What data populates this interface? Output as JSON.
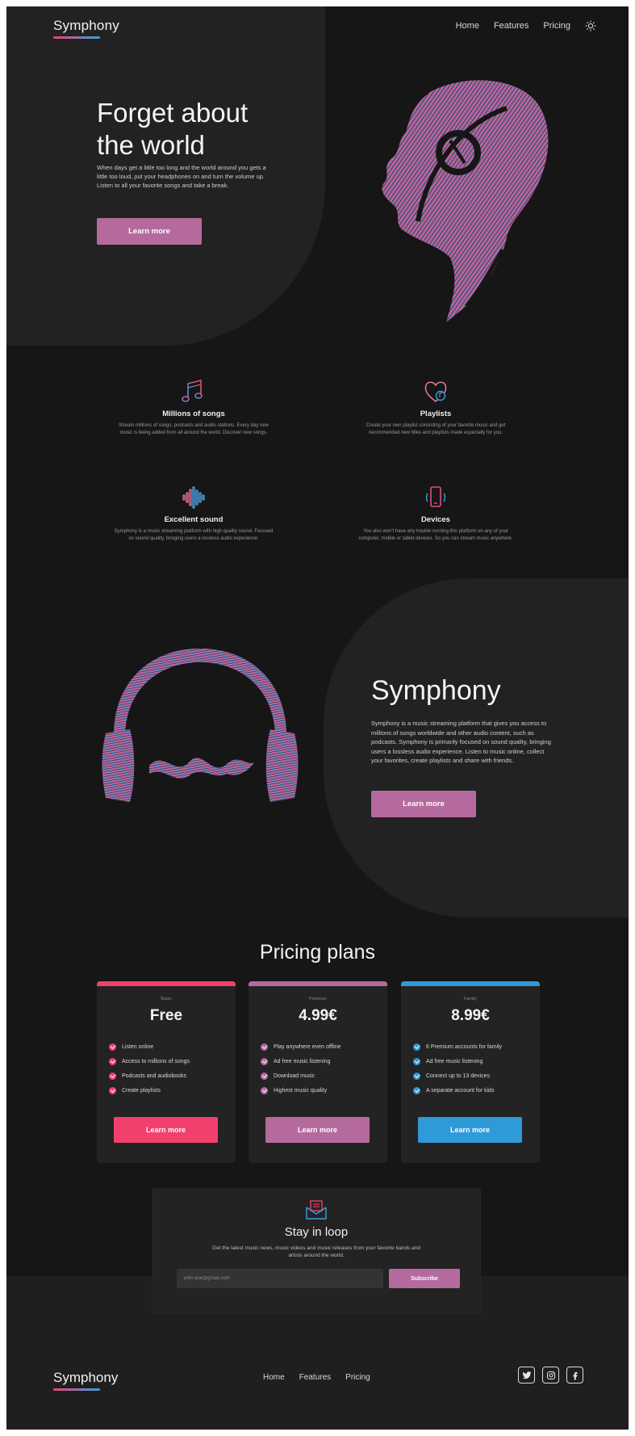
{
  "nav": {
    "logo": "Symphony",
    "links": [
      "Home",
      "Features",
      "Pricing"
    ],
    "theme_icon": "sun-icon"
  },
  "hero": {
    "title": "Forget about the world",
    "text": "When days get a little too long and the world around you gets a little too loud, put your headphones on and turn the volume up. Listen to all your favorite songs and take a break.",
    "button": "Learn more"
  },
  "features": [
    {
      "icon": "music-note-icon",
      "title": "Millions of songs",
      "text": "Stream millions of songs, podcasts and audio stations. Every day new music is being added from all around the world. Discover new songs."
    },
    {
      "icon": "heart-playlist-icon",
      "title": "Playlists",
      "text": "Create your own playlist consisting of your favorite music and get recommended new titles and playlists made especially for you."
    },
    {
      "icon": "sound-wave-icon",
      "title": "Excellent sound",
      "text": "Symphony is a music streaming platform with high quality sound. Focused on sound quality, bringing users a lossless audio experience."
    },
    {
      "icon": "phone-devices-icon",
      "title": "Devices",
      "text": "You also won't have any trouble running this platform on any of your computer, mobile or tablet devices. So you can stream music anywhere."
    }
  ],
  "about": {
    "title": "Symphony",
    "text": "Symphony is a music streaming platform that gives you access to millions of songs worldwide and other audio content, such as podcasts. Symphony is primarily focused on sound quality, bringing users a lossless audio experience. Listen to music online, collect your favorites, create playlists and share with friends.",
    "button": "Learn more"
  },
  "pricing": {
    "title": "Pricing plans",
    "plans": [
      {
        "name": "Basic",
        "price": "Free",
        "color": "#f2406d",
        "features": [
          "Listen online",
          "Access to millions of songs",
          "Podcasts and audiobooks",
          "Create playlists"
        ],
        "button": "Learn more"
      },
      {
        "name": "Premium",
        "price": "4.99€",
        "color": "#b56a9e",
        "features": [
          "Play anywhere even offline",
          "Ad free music listening",
          "Download music",
          "Highest music quality"
        ],
        "button": "Learn more"
      },
      {
        "name": "Family",
        "price": "8.99€",
        "color": "#2f9ad8",
        "features": [
          "6 Premium accounts for family",
          "Ad free music listening",
          "Connect up to 13 devices",
          "A separate account for kids"
        ],
        "button": "Learn more"
      }
    ]
  },
  "newsletter": {
    "title": "Stay in loop",
    "text": "Get the latest music news, music videos and music releases from your favorite bands and artists around the world.",
    "placeholder": "john.doe@gmail.com",
    "button": "Subscribe"
  },
  "footer": {
    "logo": "Symphony",
    "links": [
      "Home",
      "Features",
      "Pricing"
    ],
    "social": [
      "twitter-icon",
      "instagram-icon",
      "facebook-icon"
    ]
  },
  "colors": {
    "background": "#161616",
    "panel": "#222222",
    "accent": "#b56a9e",
    "pink": "#f2406d",
    "blue": "#2f9ad8"
  }
}
